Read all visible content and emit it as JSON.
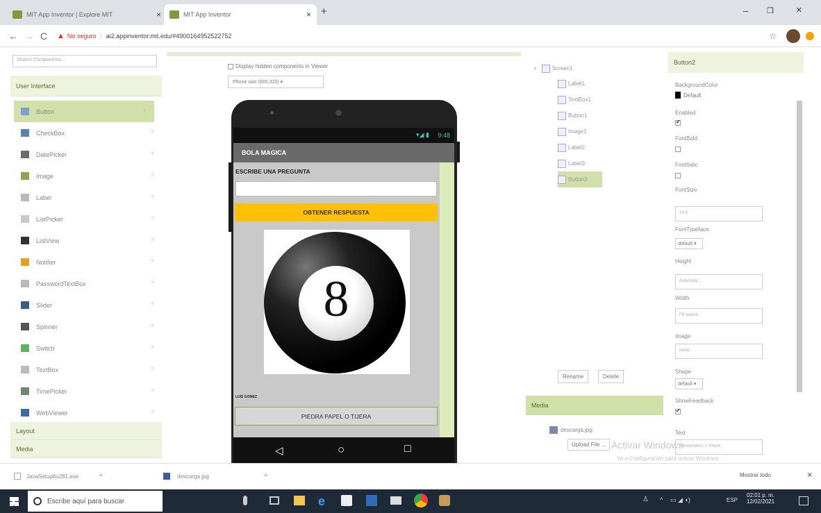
{
  "browser": {
    "tabs": [
      {
        "title": "MIT App Inventor | Explore MIT",
        "close": "×"
      },
      {
        "title": "MIT App Inventor",
        "close": "×"
      }
    ],
    "new_tab": "+",
    "nav": {
      "back": "←",
      "forward": "→",
      "reload": "C"
    },
    "security_label": "No seguro",
    "url": "ai2.appinventor.mit.edu/#4900164952522752",
    "window_controls": {
      "minimize": "–",
      "restore": "❐",
      "close": "×"
    }
  },
  "palette": {
    "search_placeholder": "Search Components...",
    "category": "User Interface",
    "items": [
      {
        "label": "Button",
        "color": "#7f9ec9"
      },
      {
        "label": "CheckBox",
        "color": "#5a7fb5"
      },
      {
        "label": "DatePicker",
        "color": "#6b6b6b"
      },
      {
        "label": "Image",
        "color": "#8aa84b"
      },
      {
        "label": "Label",
        "color": "#b9b9b9"
      },
      {
        "label": "ListPicker",
        "color": "#c9c9c9"
      },
      {
        "label": "ListView",
        "color": "#333333"
      },
      {
        "label": "Notifier",
        "color": "#e6a020"
      },
      {
        "label": "PasswordTextBox",
        "color": "#bbbbbb"
      },
      {
        "label": "Slider",
        "color": "#3e5c8a"
      },
      {
        "label": "Spinner",
        "color": "#555555"
      },
      {
        "label": "Switch",
        "color": "#5fb35f"
      },
      {
        "label": "TextBox",
        "color": "#bbbbbb"
      },
      {
        "label": "TimePicker",
        "color": "#6a8a6a"
      },
      {
        "label": "WebViewer",
        "color": "#3a6aa8"
      }
    ],
    "help_glyph": "?",
    "categories_below": [
      "Layout",
      "Media"
    ]
  },
  "viewer": {
    "hidden_components_label": "Display hidden components in Viewer",
    "phone_size": "Phone size (505,320)",
    "status_time": "9:48",
    "app_title": "BOLA MAGICA",
    "question_label": "ESCRIBE UNA PREGUNTA",
    "primary_button": "OBTENER RESPUESTA",
    "ball_number": "8",
    "author_label": "LUIS GOMEZ",
    "secondary_button": "PIEDRA PAPEL O TIJERA",
    "nav_back": "◁",
    "nav_home": "○",
    "nav_recent": "□"
  },
  "components": {
    "root": "Screen1",
    "children": [
      "Label1",
      "TextBox1",
      "Button1",
      "Image1",
      "Label2",
      "Label3",
      "Button2"
    ],
    "selected": "Button2",
    "rename": "Rename",
    "delete": "Delete"
  },
  "media": {
    "title": "Media",
    "file": "descarga.jpg",
    "upload": "Upload File ..."
  },
  "properties": {
    "component": "Button2",
    "background_color_label": "BackgroundColor",
    "background_color_value": "Default",
    "enabled_label": "Enabled",
    "font_bold_label": "FontBold",
    "font_italic_label": "FontItalic",
    "font_size_label": "FontSize",
    "font_size_value": "14.0",
    "font_typeface_label": "FontTypeface",
    "font_typeface_value": "default",
    "height_label": "Height",
    "height_value": "Automatic...",
    "width_label": "Width",
    "width_value": "Fill parent...",
    "image_label": "Image",
    "image_value": "None...",
    "shape_label": "Shape",
    "shape_value": "default",
    "show_feedback_label": "ShowFeedback",
    "text_label": "Text",
    "text_value": "PIEDRA PAPEL O TIJERA",
    "watermark_1": "Activar Windows",
    "watermark_2": "Ve a Configuración para activar Windows."
  },
  "downloads": {
    "items": [
      "JavaSetup8u281.exe",
      "descarga.jpg"
    ],
    "chevron": "^",
    "show_all": "Mostrar todo",
    "close": "×"
  },
  "taskbar": {
    "search_placeholder": "Escribe aquí para buscar",
    "time": "02:01 p. m.",
    "date": "12/02/2021",
    "language": "ESP",
    "tray_glyph": "^"
  }
}
